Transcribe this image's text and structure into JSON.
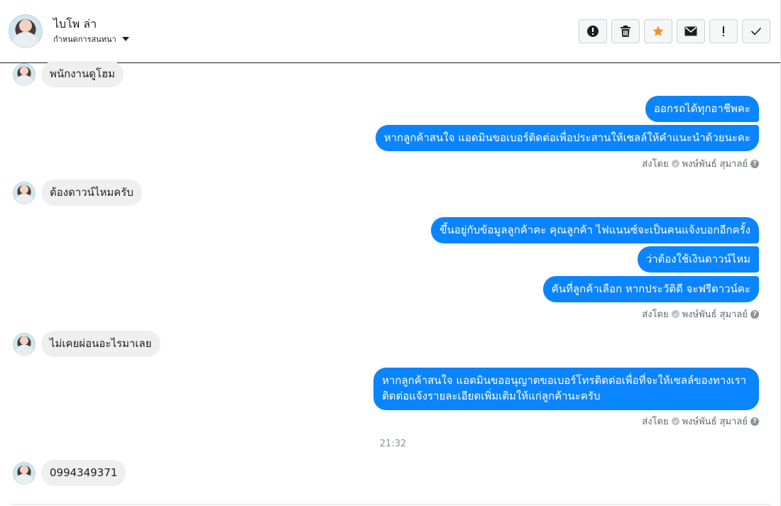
{
  "header": {
    "contact_name": "ไบโพ ล่า",
    "subtitle": "กำหนดการสนทนา",
    "toolbar": [
      {
        "name": "report-icon",
        "symbol": "!"
      },
      {
        "name": "trash-icon",
        "symbol": "trash"
      },
      {
        "name": "star-icon",
        "symbol": "star",
        "color": "#f28c28"
      },
      {
        "name": "envelope-icon",
        "symbol": "envelope"
      },
      {
        "name": "exclamation-icon",
        "symbol": "!"
      },
      {
        "name": "check-icon",
        "symbol": "check"
      }
    ]
  },
  "messages": {
    "in1": "พนักงานดูโฮม",
    "out1a": "ออกรถได้ทุกอาชีพคะ",
    "out1b": "หากลูกค้าสนใจ แอดมินขอเบอร์ติดต่อเพื่อประสานให้เซลล์ให้คำแนะนำด้วยนะคะ",
    "sent1": "ส่งโดย",
    "sender1": "พงษ์พันธ์ สุมาลย์",
    "in2": "ต้องดาวน์ไหมครับ",
    "out2a": "ขึ้นอยู่กับข้อมูลลูกค้าคะ คุณลูกค้า ไฟแนนซ์จะเป็นคนแจ้งบอกอีกครั้ง",
    "out2b": "ว่าต้องใช้เงินดาวน์ไหม",
    "out2c": "คันที่ลูกค้าเลือก หากประวัติดี จะฟรีดาวน์คะ",
    "sent2": "ส่งโดย",
    "sender2": "พงษ์พันธ์ สุมาลย์",
    "in3": "ไม่เคยผ่อนอะไรมาเลย",
    "out3": "หากลูกค้าสนใจ แอดมินขออนุญาตขอเบอร์โทรติดต่อเพื่อที่จะให้เซลล์ของทางเราติดต่อแจ้งรายละเอียดเพิ่มเติมให้แก่ลูกค้านะครับ",
    "sent3": "ส่งโดย",
    "sender3": "พงษ์พันธ์ สุมาลย์",
    "time": "21:32",
    "in4": "0994349371"
  },
  "colors": {
    "outgoing_bubble": "#0b84ff",
    "incoming_bubble": "#efefef",
    "star": "#f28c28"
  }
}
